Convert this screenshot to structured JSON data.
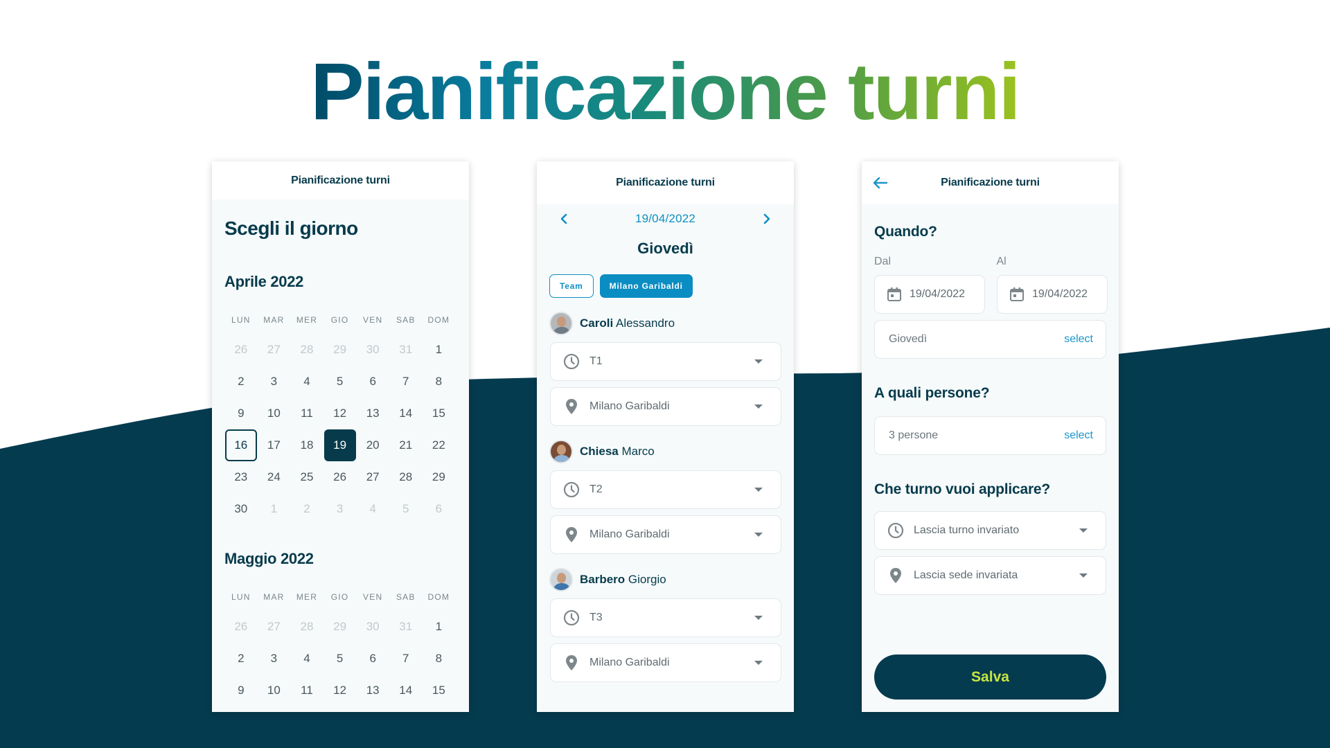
{
  "colors": {
    "navy": "#053b4f",
    "accent_blue": "#0f8fc2",
    "lime": "#c6e641",
    "panel_bg": "#f6fafb"
  },
  "hero": {
    "title": "Pianificazione turni"
  },
  "panel1": {
    "header_title": "Pianificazione turni",
    "page_title": "Scegli il giorno",
    "weekdays": [
      "LUN",
      "MAR",
      "MER",
      "GIO",
      "VEN",
      "SAB",
      "DOM"
    ],
    "months": [
      {
        "title": "Aprile 2022",
        "weeks": [
          [
            {
              "d": "26",
              "m": true
            },
            {
              "d": "27",
              "m": true
            },
            {
              "d": "28",
              "m": true
            },
            {
              "d": "29",
              "m": true
            },
            {
              "d": "30",
              "m": true
            },
            {
              "d": "31",
              "m": true
            },
            {
              "d": "1"
            }
          ],
          [
            {
              "d": "2"
            },
            {
              "d": "3"
            },
            {
              "d": "4"
            },
            {
              "d": "5"
            },
            {
              "d": "6"
            },
            {
              "d": "7"
            },
            {
              "d": "8"
            }
          ],
          [
            {
              "d": "9"
            },
            {
              "d": "10"
            },
            {
              "d": "11"
            },
            {
              "d": "12"
            },
            {
              "d": "13"
            },
            {
              "d": "14"
            },
            {
              "d": "15"
            }
          ],
          [
            {
              "d": "16",
              "today": true
            },
            {
              "d": "17"
            },
            {
              "d": "18"
            },
            {
              "d": "19",
              "selected": true
            },
            {
              "d": "20"
            },
            {
              "d": "21"
            },
            {
              "d": "22"
            }
          ],
          [
            {
              "d": "23"
            },
            {
              "d": "24"
            },
            {
              "d": "25"
            },
            {
              "d": "26"
            },
            {
              "d": "27"
            },
            {
              "d": "28"
            },
            {
              "d": "29"
            }
          ],
          [
            {
              "d": "30"
            },
            {
              "d": "1",
              "m": true
            },
            {
              "d": "2",
              "m": true
            },
            {
              "d": "3",
              "m": true
            },
            {
              "d": "4",
              "m": true
            },
            {
              "d": "5",
              "m": true
            },
            {
              "d": "6",
              "m": true
            }
          ]
        ]
      },
      {
        "title": "Maggio 2022",
        "weeks": [
          [
            {
              "d": "26",
              "m": true
            },
            {
              "d": "27",
              "m": true
            },
            {
              "d": "28",
              "m": true
            },
            {
              "d": "29",
              "m": true
            },
            {
              "d": "30",
              "m": true
            },
            {
              "d": "31",
              "m": true
            },
            {
              "d": "1"
            }
          ],
          [
            {
              "d": "2"
            },
            {
              "d": "3"
            },
            {
              "d": "4"
            },
            {
              "d": "5"
            },
            {
              "d": "6"
            },
            {
              "d": "7"
            },
            {
              "d": "8"
            }
          ],
          [
            {
              "d": "9"
            },
            {
              "d": "10"
            },
            {
              "d": "11"
            },
            {
              "d": "12"
            },
            {
              "d": "13"
            },
            {
              "d": "14"
            },
            {
              "d": "15"
            }
          ]
        ]
      }
    ]
  },
  "panel2": {
    "header_title": "Pianificazione turni",
    "date": "19/04/2022",
    "day_name": "Giovedì",
    "prev_icon": "chevron-left-icon",
    "next_icon": "chevron-right-icon",
    "chips": [
      {
        "label": "Team",
        "active": false
      },
      {
        "label": "Milano Garibaldi",
        "active": true
      }
    ],
    "people": [
      {
        "surname": "Caroli",
        "name": "Alessandro",
        "shift": "T1",
        "location": "Milano Garibaldi"
      },
      {
        "surname": "Chiesa",
        "name": "Marco",
        "shift": "T2",
        "location": "Milano Garibaldi"
      },
      {
        "surname": "Barbero",
        "name": "Giorgio",
        "shift": "T3",
        "location": "Milano Garibaldi"
      }
    ]
  },
  "panel3": {
    "header_title": "Pianificazione turni",
    "back_icon": "arrow-left-icon",
    "when_title": "Quando?",
    "from_label": "Dal",
    "to_label": "Al",
    "from_date": "19/04/2022",
    "to_date": "19/04/2022",
    "weekday_value": "Giovedì",
    "select_label": "select",
    "people_title": "A quali persone?",
    "people_value": "3 persone",
    "shift_title": "Che turno vuoi applicare?",
    "shift_value": "Lascia turno invariato",
    "location_value": "Lascia sede invariata",
    "save_label": "Salva"
  }
}
